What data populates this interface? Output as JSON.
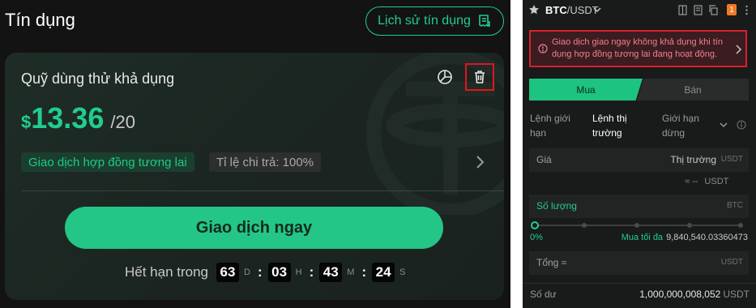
{
  "left": {
    "title": "Tín dụng",
    "history_button": "Lịch sử tín dụng",
    "card": {
      "title": "Quỹ dùng thử khả dụng",
      "currency_symbol": "$",
      "amount": "13.36",
      "denominator": "/20",
      "tags": [
        "Giao dịch hợp đồng tương lai",
        "Tỉ lệ chi trả: 100%"
      ],
      "trade_button": "Giao dịch ngay",
      "expire_label": "Hết hạn trong",
      "countdown": {
        "d": "63",
        "h": "03",
        "m": "43",
        "s": "24"
      },
      "units": {
        "d": "D",
        "h": "H",
        "m": "M",
        "s": "S"
      }
    }
  },
  "right": {
    "pair_base": "BTC",
    "pair_quote": "/USDT",
    "badge": "1",
    "alert_text": "Giao dịch giao ngay không khả dụng khi tín dụng hợp đồng tương lai đang hoạt động.",
    "tabs": {
      "buy": "Mua",
      "sell": "Bán"
    },
    "order_types": [
      "Lệnh giới hạn",
      "Lệnh thị trường",
      "Giới hạn dừng"
    ],
    "price": {
      "label": "Giá",
      "value": "Thị trường",
      "unit": "USDT"
    },
    "estimate": {
      "value": "≈ --",
      "unit": "USDT"
    },
    "quantity": {
      "label": "Số lượng",
      "unit": "BTC"
    },
    "slider_percent": "0%",
    "max_buy_label": "Mua tối đa",
    "max_buy_value": "9,840,540.03360473",
    "total": {
      "label": "Tổng ≈",
      "unit": "USDT"
    },
    "balance": {
      "label": "Số dư",
      "value": "1,000,000,008,052",
      "unit": "USDT"
    }
  },
  "colors": {
    "accent": "#1fce8d",
    "alert_border": "#e0161d",
    "bg": "#131313"
  }
}
